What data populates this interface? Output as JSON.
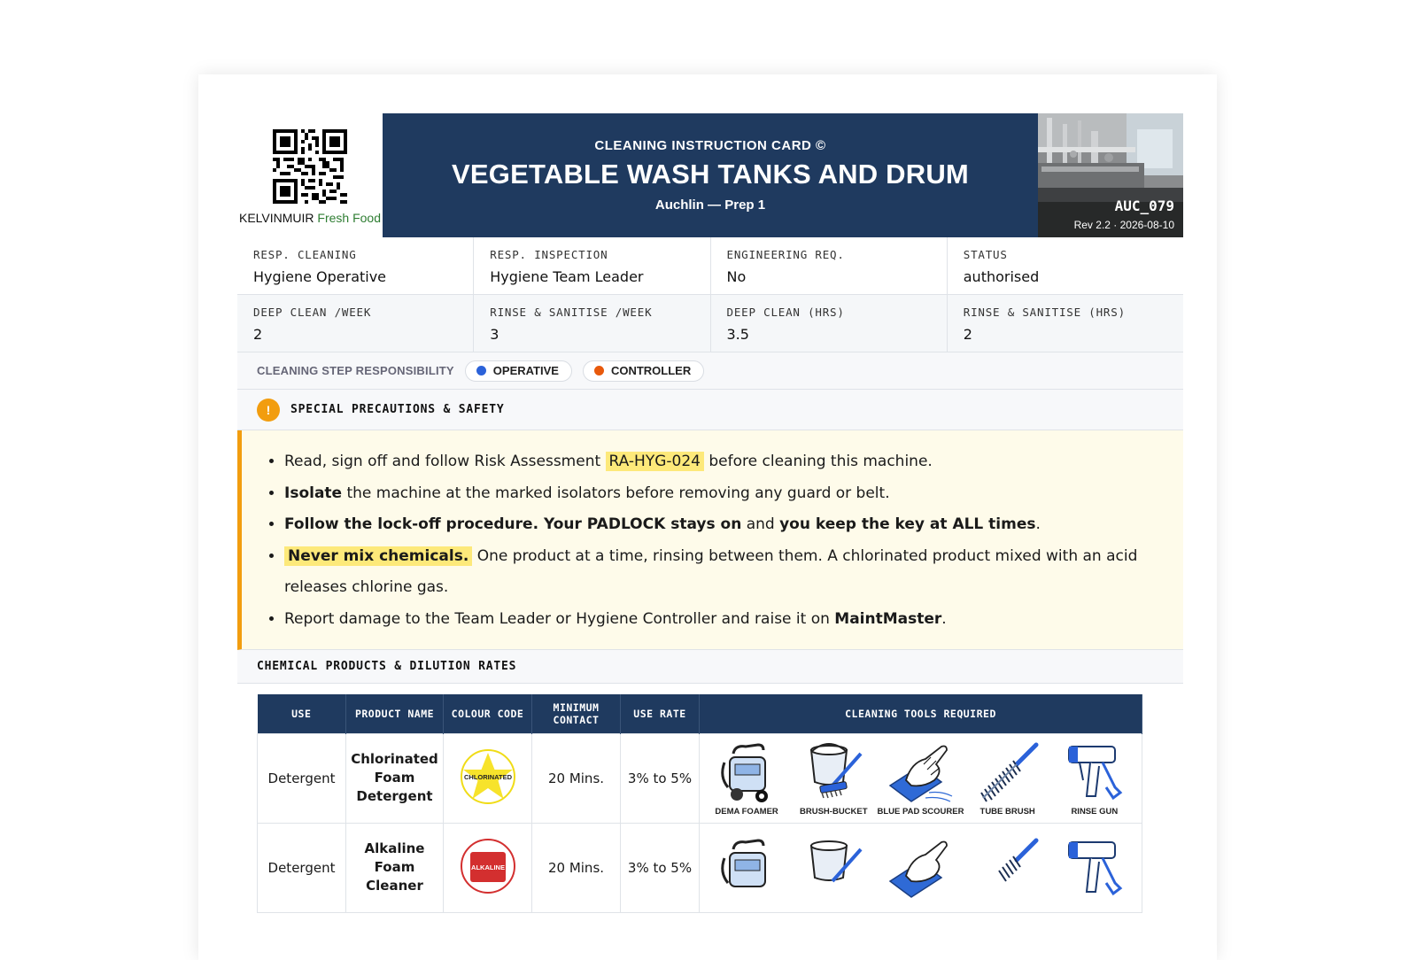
{
  "brand": {
    "name": "KELVINMUIR",
    "name_suffix": "Fresh Food"
  },
  "title": {
    "kicker": "CLEANING INSTRUCTION CARD ©",
    "main": "VEGETABLE WASH TANKS AND DRUM",
    "sub": "Auchlin — Prep 1"
  },
  "photo": {
    "code": "AUC_079",
    "revision": "Rev 2.2 · 2026-08-10"
  },
  "info": {
    "row1": [
      {
        "label": "RESP. CLEANING",
        "value": "Hygiene Operative"
      },
      {
        "label": "RESP. INSPECTION",
        "value": "Hygiene Team Leader"
      },
      {
        "label": "ENGINEERING REQ.",
        "value": "No"
      },
      {
        "label": "STATUS",
        "value": "authorised"
      }
    ],
    "row2": [
      {
        "label": "DEEP CLEAN /WEEK",
        "value": "2"
      },
      {
        "label": "RINSE & SANITISE /WEEK",
        "value": "3"
      },
      {
        "label": "DEEP CLEAN (HRS)",
        "value": "3.5"
      },
      {
        "label": "RINSE & SANITISE (HRS)",
        "value": "2"
      }
    ]
  },
  "responsibility": {
    "label": "CLEANING STEP RESPONSIBILITY",
    "operative": "OPERATIVE",
    "controller": "CONTROLLER",
    "operative_color": "#2b62d9",
    "controller_color": "#e8590c"
  },
  "precautions": {
    "title": "SPECIAL PRECAUTIONS & SAFETY",
    "icon": "!",
    "items": {
      "i1_a": "Read, sign off and follow Risk Assessment",
      "i1_code": "RA-HYG-024",
      "i1_b": "before cleaning this machine.",
      "i2_bold": "Isolate",
      "i2_rest": "the machine at the marked isolators before removing any guard or belt.",
      "i3_bold1": "Follow the lock-off procedure. Your PADLOCK stays on",
      "i3_and": "and",
      "i3_bold2": "you keep the key at ALL times",
      "i3_end": ".",
      "i4_hl": "Never mix chemicals.",
      "i4_rest": "One product at a time, rinsing between them. A chlorinated product mixed with an acid releases chlorine gas.",
      "i5_a": "Report damage to the Team Leader or Hygiene Controller and raise it on",
      "i5_bold": "MaintMaster",
      "i5_end": "."
    }
  },
  "chemicals": {
    "title": "CHEMICAL PRODUCTS & DILUTION RATES",
    "headers": {
      "use": "USE",
      "product": "PRODUCT NAME",
      "colour": "COLOUR CODE",
      "contact": "MINIMUM CONTACT",
      "rate": "USE RATE",
      "tools": "CLEANING TOOLS REQUIRED"
    },
    "rows": [
      {
        "use": "Detergent",
        "product": "Chlorinated Foam Detergent",
        "colour_label": "CHLORINATED",
        "contact": "20 Mins.",
        "rate": "3% to 5%"
      },
      {
        "use": "Detergent",
        "product": "Alkaline Foam Cleaner",
        "colour_label": "ALKALINE",
        "contact": "20 Mins.",
        "rate": "3% to 5%"
      }
    ],
    "tools": [
      "DEMA FOAMER",
      "BRUSH-BUCKET",
      "BLUE PAD SCOURER",
      "TUBE BRUSH",
      "RINSE GUN"
    ]
  }
}
